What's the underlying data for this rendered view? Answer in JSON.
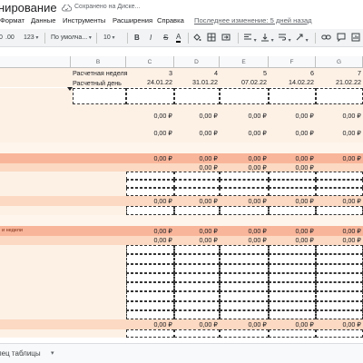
{
  "title_bar": {
    "doc_title": "нирование",
    "save_status": "Сохранено на Диске..."
  },
  "menu": {
    "items": [
      "Формат",
      "Данные",
      "Инструменты",
      "Расширения",
      "Справка"
    ],
    "last_edit": "Последнее изменение: 5 дней назад"
  },
  "toolbar": {
    "decimals_label": "0",
    "decimals_more": ".00",
    "number_format": "123",
    "font_name": "По умолча...",
    "font_size": "10",
    "bold": "B",
    "italic": "I",
    "strike": "S",
    "text_color": "A"
  },
  "columns": [
    "B",
    "C",
    "D",
    "E",
    "F",
    "G"
  ],
  "header_rows": {
    "week_label": "Расчетная неделя",
    "week_numbers": [
      "3",
      "4",
      "5",
      "6",
      "7"
    ],
    "day_label": "Расчетный день",
    "dates": [
      "24.01.22",
      "31.01.22",
      "07.02.22",
      "14.02.22",
      "21.02.22"
    ]
  },
  "values": {
    "zero_rub": "0,00 ₽"
  },
  "row_labels": {
    "weekly_note": "и недели"
  },
  "sheet_tab": {
    "label": "лец таблицы"
  },
  "colors": {
    "orange_row": "#f9b59a",
    "light_row": "#fcd9c2",
    "base_bg": "#fdf1e6"
  }
}
